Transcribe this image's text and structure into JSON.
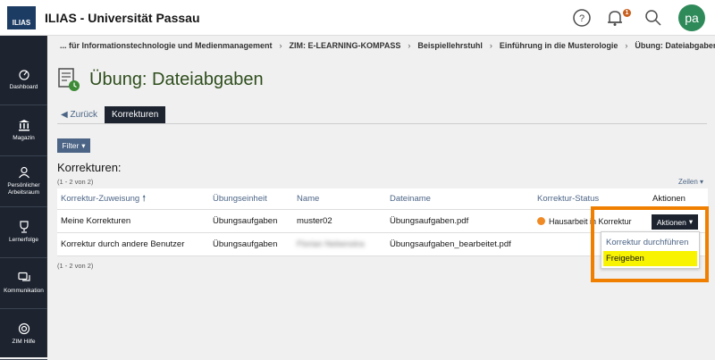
{
  "app": {
    "logo_text": "ILIAS",
    "title": "ILIAS - Universität Passau",
    "avatar_initials": "pa",
    "notification_count": "1"
  },
  "breadcrumb": [
    "... für Informationstechnologie und Medienmanagement",
    "ZIM: E-LEARNING-KOMPASS",
    "Beispiellehrstuhl",
    "Einführung in die Musterologie",
    "Übung: Dateiabgaben"
  ],
  "sidebar": {
    "items": [
      {
        "label": "Dashboard",
        "icon": "dashboard-icon"
      },
      {
        "label": "Magazin",
        "icon": "library-icon"
      },
      {
        "label": "Persönlicher Arbeitsraum",
        "icon": "person-icon"
      },
      {
        "label": "Lernerfolge",
        "icon": "trophy-icon"
      },
      {
        "label": "Kommunikation",
        "icon": "chat-icon"
      },
      {
        "label": "ZIM Hilfe",
        "icon": "lifebuoy-icon"
      }
    ]
  },
  "page": {
    "title": "Übung: Dateiabgaben"
  },
  "tabs": {
    "back": "Zurück",
    "active": "Korrekturen"
  },
  "filter": {
    "label": "Filter"
  },
  "table": {
    "title": "Korrekturen:",
    "count_top": "(1 - 2 von 2)",
    "count_bottom": "(1 - 2 von 2)",
    "rows_link": "Zeilen",
    "headers": [
      "Korrektur-Zuweisung",
      "Übungseinheit",
      "Name",
      "Dateiname",
      "Korrektur-Status",
      "Aktionen"
    ],
    "rows": [
      {
        "assignment": "Meine Korrekturen",
        "unit": "Übungsaufgaben",
        "name": "muster02",
        "file": "Übungsaufgaben.pdf",
        "status": "Hausarbeit in Korrektur"
      },
      {
        "assignment": "Korrektur durch andere Benutzer",
        "unit": "Übungsaufgaben",
        "name": "Florian Nebenstra",
        "file": "Übungsaufgaben_bearbeitet.pdf",
        "status": ""
      }
    ]
  },
  "actions": {
    "button": "Aktionen",
    "menu": [
      "Korrektur durchführen",
      "Freigeben"
    ]
  },
  "colors": {
    "accent": "#4c6586",
    "title_green": "#2e4e1c",
    "sidebar": "#1d2430",
    "highlight": "#f07f00",
    "yellow": "#f8f300"
  }
}
